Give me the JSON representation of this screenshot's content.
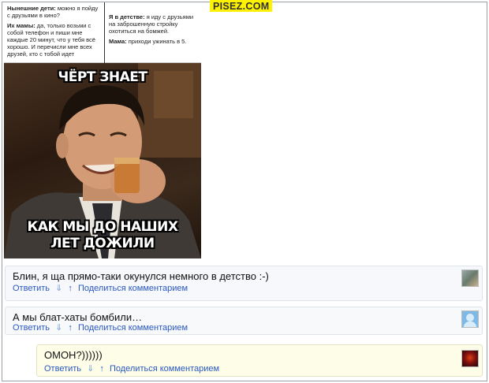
{
  "watermark": "PISEZ.COM",
  "panel": {
    "left": {
      "p1_label": "Нынешние дети:",
      "p1_text": " можно я пойду с друзьями в кино?",
      "p2_label": "Их мамы:",
      "p2_text": " да, только возьми с собой телефон и пиши мне каждые 20 минут, что у тебя всё хорошо. И перечисли мне всех друзей, кто с тобой идет"
    },
    "right": {
      "p1_label": "Я в детстве:",
      "p1_text": " я иду с друзьями на заброшенную стройку охотиться на бомжей.",
      "p2_label": "Мама:",
      "p2_text": " приходи ужинать в 5."
    }
  },
  "meme": {
    "caption_top": "ЧЁРТ ЗНАЕТ",
    "caption_bottom_1": "КАК МЫ ДО НАШИХ",
    "caption_bottom_2": "ЛЕТ ДОЖИЛИ"
  },
  "comments": [
    {
      "text": "Блин, я ща прямо-таки окунулся немного в детство :-)",
      "reply": "Ответить",
      "down": "⇓",
      "up": "↑",
      "share": "Поделиться комментарием",
      "avatar_icon": "user-photo-icon"
    },
    {
      "text": "А мы блат-хаты бомбили…",
      "reply": "Ответить",
      "down": "⇓",
      "up": "↑",
      "share": "Поделиться комментарием",
      "avatar_icon": "default-user-icon"
    },
    {
      "text": "ОМОН?))))))",
      "reply": "Ответить",
      "down": "⇓",
      "up": "↑",
      "share": "Поделиться комментарием",
      "avatar_icon": "user-photo-icon"
    }
  ],
  "colors": {
    "watermark_bg": "#fff200",
    "link": "#2a58c2",
    "reply_highlight_bg": "#fdfde8"
  }
}
